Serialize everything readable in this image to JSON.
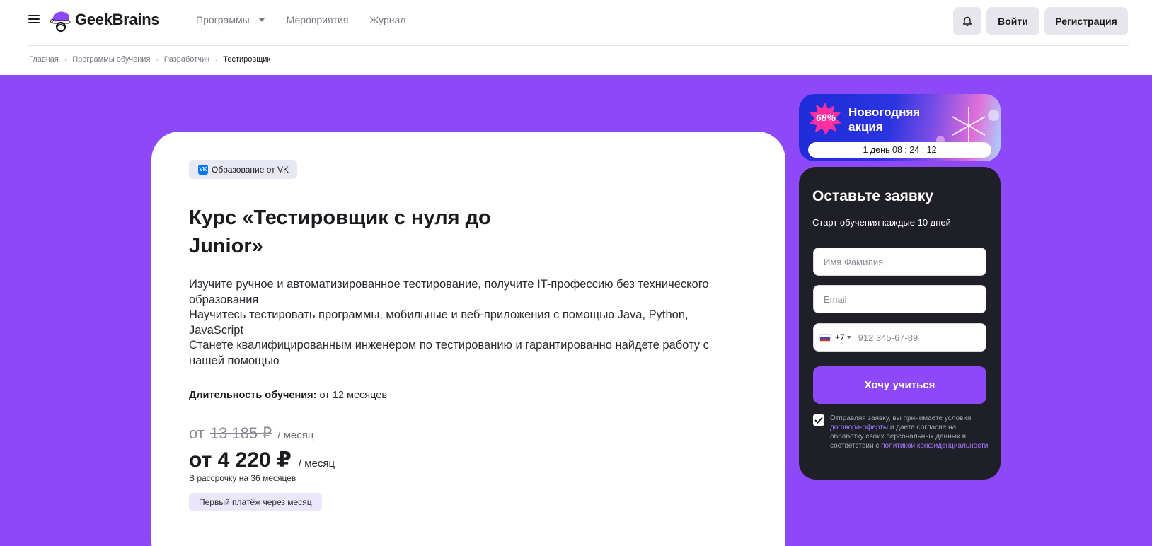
{
  "header": {
    "logo_text": "GeekBrains",
    "nav": [
      {
        "label": "Программы",
        "has_dropdown": true
      },
      {
        "label": "Мероприятия"
      },
      {
        "label": "Журнал"
      }
    ],
    "bell_icon": "bell-icon",
    "login_label": "Войти",
    "register_label": "Регистрация"
  },
  "breadcrumb": [
    "Главная",
    "Программы обучения",
    "Разработчик",
    "Тестировщик"
  ],
  "course": {
    "badge": "Образование от VK",
    "badge_icon": "vk-icon",
    "title": "Курс «Тестировщик с нуля до Junior»",
    "description": [
      "Изучите ручное и автоматизированное тестирование, получите IT-профессию без технического образования",
      "Научитесь тестировать программы, мобильные и веб-приложения с помощью Java, Python, JavaScript",
      "Станете квалифицированным инженером по тестированию и гарантированно найдете работу с нашей помощью"
    ],
    "duration_label": "Длительность обучения:",
    "duration_value": "от 12 месяцев",
    "old_price_prefix": "от",
    "old_price": "13 185 ₽",
    "per_month": "/ месяц",
    "new_price": "от 4 220 ₽",
    "installment": "В рассрочку на 36 месяцев",
    "first_payment": "Первый платёж через месяц"
  },
  "promo": {
    "discount": "68%",
    "title_line1": "Новогодняя",
    "title_line2": "акция",
    "timer": "1 день 08 : 24 : 12"
  },
  "form": {
    "title": "Оставьте заявку",
    "subtitle": "Старт обучения каждые 10 дней",
    "name_placeholder": "Имя Фамилия",
    "email_placeholder": "Email",
    "phone_code": "+7",
    "phone_placeholder": "912 345-67-89",
    "submit_label": "Хочу учиться",
    "consent_checked": true,
    "consent_part1": "Отправляя заявку, вы принимаете условия",
    "consent_link1": "договора-оферты",
    "consent_part2": "и даете согласие на обработку своих персональных данных в соответствии с",
    "consent_link2": "политикой конфиденциальности",
    "consent_end": "."
  },
  "colors": {
    "accent": "#8d49f7",
    "dark_panel": "#1e1f27"
  }
}
